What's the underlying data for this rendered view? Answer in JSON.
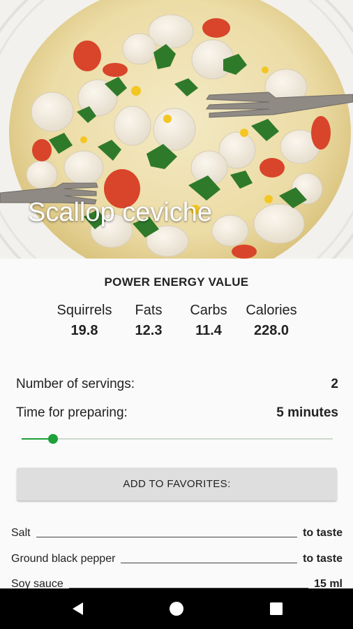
{
  "recipe": {
    "title": "Scallop ceviche",
    "image_icon": "scallop-ceviche-photo"
  },
  "energy": {
    "title": "POWER ENERGY VALUE",
    "nutrients": [
      {
        "label": "Squirrels",
        "value": "19.8"
      },
      {
        "label": "Fats",
        "value": "12.3"
      },
      {
        "label": "Carbs",
        "value": "11.4"
      },
      {
        "label": "Calories",
        "value": "228.0"
      }
    ]
  },
  "info": {
    "servings_label": "Number of servings:",
    "servings_value": "2",
    "time_label": "Time for preparing:",
    "time_value": "5 minutes"
  },
  "slider": {
    "value_fraction": 0.1
  },
  "actions": {
    "favorites_label": "ADD TO FAVORITES:"
  },
  "ingredients": [
    {
      "name": "Salt",
      "qty": "to taste"
    },
    {
      "name": "Ground black pepper",
      "qty": "to taste"
    },
    {
      "name": "Soy sauce",
      "qty": "15 ml"
    }
  ],
  "navbar": {
    "back_icon": "back-triangle-icon",
    "home_icon": "home-circle-icon",
    "recent_icon": "recent-apps-square-icon"
  },
  "colors": {
    "accent": "#1ea03a",
    "button_bg": "#dedede",
    "navbar_bg": "#000000"
  }
}
